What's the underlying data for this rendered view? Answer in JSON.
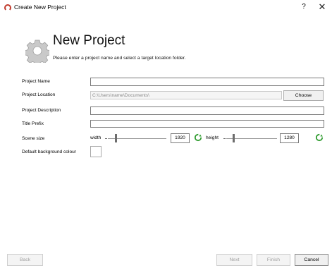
{
  "window": {
    "title": "Create New Project",
    "help_label": "?",
    "close_label": "✕"
  },
  "header": {
    "title": "New Project",
    "subtitle": "Please enter a project name and select a target location folder."
  },
  "form": {
    "project_name_label": "Project Name",
    "project_name_value": "",
    "project_location_label": "Project Location",
    "project_location_value": "C:\\Users\\name\\Documents\\",
    "choose_label": "Choose",
    "project_description_label": "Project Description",
    "project_description_value": "",
    "title_prefix_label": "Title Prefix",
    "title_prefix_value": "",
    "scene_size_label": "Scene size",
    "width_label": "width",
    "width_value": "1920",
    "height_label": "height",
    "height_value": "1280",
    "bg_colour_label": "Default background colour",
    "bg_colour": "#ffffff"
  },
  "footer": {
    "back_label": "Back",
    "next_label": "Next",
    "finish_label": "Finish",
    "cancel_label": "Cancel"
  },
  "colors": {
    "app_icon": "#c0392b",
    "refresh_icon": "#2e9b2e"
  }
}
